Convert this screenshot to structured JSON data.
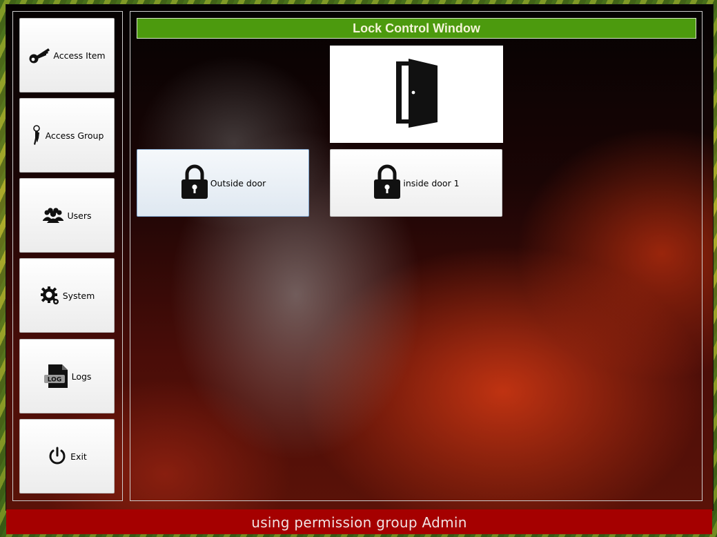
{
  "sidebar": {
    "items": [
      {
        "label": "Access Item",
        "icon": "key-icon"
      },
      {
        "label": "Access Group",
        "icon": "keys-icon"
      },
      {
        "label": "Users",
        "icon": "users-icon"
      },
      {
        "label": "System",
        "icon": "gear-icon"
      },
      {
        "label": "Logs",
        "icon": "log-file-icon",
        "icon_text": "LOG"
      },
      {
        "label": "Exit",
        "icon": "power-icon"
      }
    ]
  },
  "main": {
    "title": "Lock Control Window",
    "door_panel_icon": "door-icon",
    "locks": [
      {
        "label": "Outside door",
        "icon": "padlock-locked-icon",
        "focused": true
      },
      {
        "label": "inside door 1",
        "icon": "padlock-locked-icon",
        "focused": false
      }
    ]
  },
  "status": {
    "text": "using permission group Admin"
  },
  "colors": {
    "title_bar": "#4c9a0e",
    "status_bar": "#a50000"
  }
}
